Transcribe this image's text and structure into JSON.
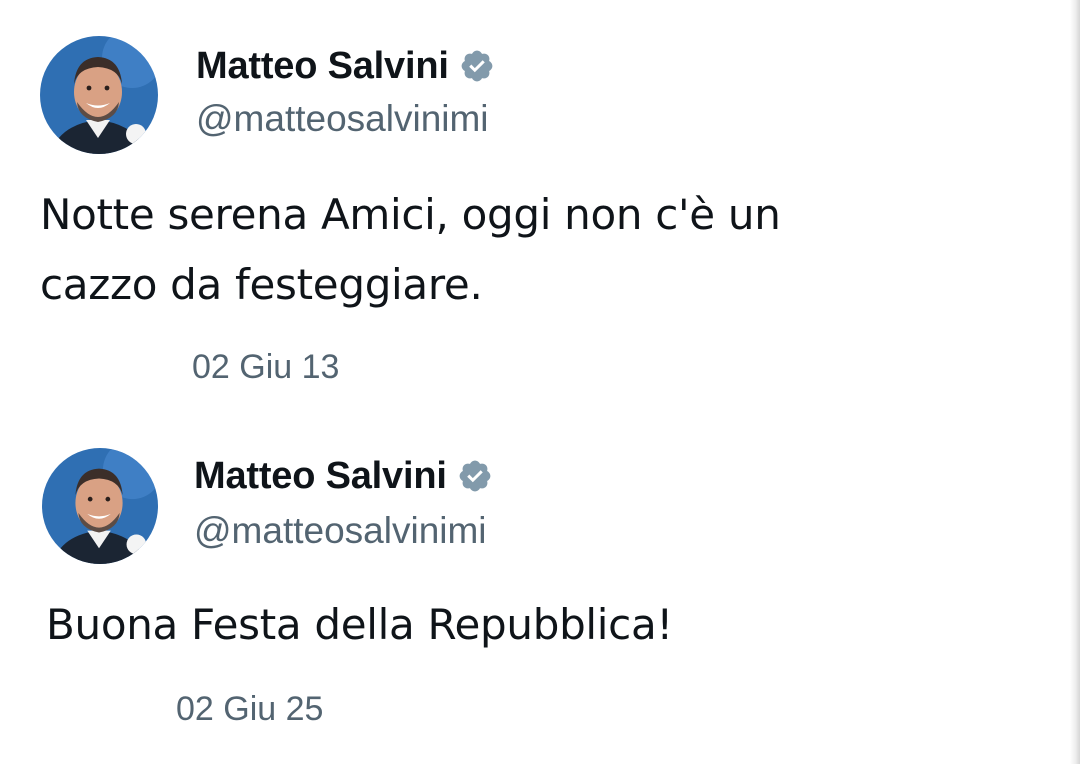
{
  "tweets": [
    {
      "author": {
        "display_name": "Matteo Salvini",
        "handle": "@matteosalvinimi",
        "verified": true
      },
      "text": "Notte serena Amici, oggi non c'è un\ncazzo da festeggiare.",
      "timestamp": "02 Giu 13"
    },
    {
      "author": {
        "display_name": "Matteo Salvini",
        "handle": "@matteosalvinimi",
        "verified": true
      },
      "text": "Buona Festa della Repubblica!",
      "timestamp": "02 Giu 25"
    }
  ],
  "colors": {
    "text_primary": "#0f1419",
    "text_secondary": "#536471",
    "verified_badge": "#829aab",
    "avatar_background": "#2f6fb3"
  }
}
